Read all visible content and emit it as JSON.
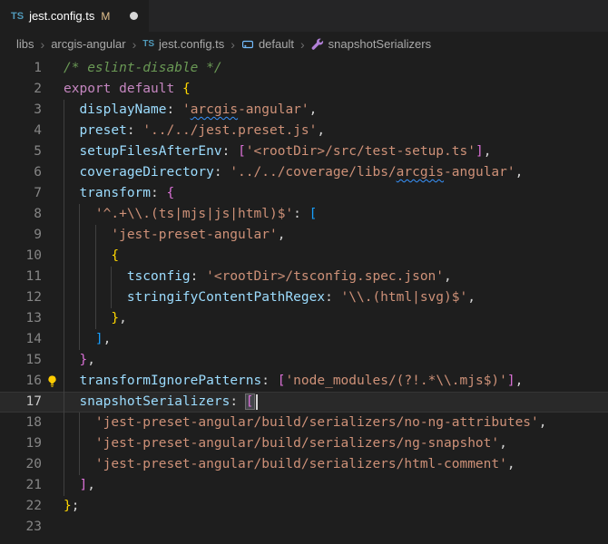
{
  "icons": {
    "ts": "TS"
  },
  "tab": {
    "title": "jest.config.ts",
    "git_status": "M",
    "dirty": true
  },
  "breadcrumb": {
    "separator": "›",
    "items": [
      {
        "label": "libs"
      },
      {
        "label": "arcgis-angular"
      },
      {
        "label": "jest.config.ts",
        "icon": "ts-file-icon"
      },
      {
        "label": "default",
        "icon": "symbol-variable-icon"
      },
      {
        "label": "snapshotSerializers",
        "icon": "symbol-property-icon"
      }
    ]
  },
  "editor": {
    "language": "typescript",
    "active_line": 17,
    "colors": {
      "comment": "#6A9955",
      "keyword": "#C586C0",
      "property": "#9CDCFE",
      "string": "#CE9178",
      "punctuation": "#D4D4D4",
      "bracket1": "#FFD700",
      "bracket2": "#DA70D6",
      "bracket3": "#179FFF",
      "squiggle": "#3794FF"
    },
    "lines": [
      {
        "num": 1,
        "guides": 0,
        "tokens": [
          {
            "s": "/* eslint-disable */",
            "c": "com"
          }
        ]
      },
      {
        "num": 2,
        "guides": 0,
        "tokens": [
          {
            "s": "export default ",
            "c": "kw"
          },
          {
            "s": "{",
            "c": "b1"
          }
        ]
      },
      {
        "num": 3,
        "guides": 1,
        "tokens": [
          {
            "s": "displayName",
            "c": "prop"
          },
          {
            "s": ": ",
            "c": "pun"
          },
          {
            "s": "'",
            "c": "str"
          },
          {
            "s": "arcgis",
            "c": "str",
            "sq": true
          },
          {
            "s": "-angular'",
            "c": "str"
          },
          {
            "s": ",",
            "c": "pun"
          }
        ]
      },
      {
        "num": 4,
        "guides": 1,
        "tokens": [
          {
            "s": "preset",
            "c": "prop"
          },
          {
            "s": ": ",
            "c": "pun"
          },
          {
            "s": "'../../jest.preset.js'",
            "c": "str"
          },
          {
            "s": ",",
            "c": "pun"
          }
        ]
      },
      {
        "num": 5,
        "guides": 1,
        "tokens": [
          {
            "s": "setupFilesAfterEnv",
            "c": "prop"
          },
          {
            "s": ": ",
            "c": "pun"
          },
          {
            "s": "[",
            "c": "b2"
          },
          {
            "s": "'<rootDir>/src/test-setup.ts'",
            "c": "str"
          },
          {
            "s": "]",
            "c": "b2"
          },
          {
            "s": ",",
            "c": "pun"
          }
        ]
      },
      {
        "num": 6,
        "guides": 1,
        "tokens": [
          {
            "s": "coverageDirectory",
            "c": "prop"
          },
          {
            "s": ": ",
            "c": "pun"
          },
          {
            "s": "'../../coverage/libs/",
            "c": "str"
          },
          {
            "s": "arcgis",
            "c": "str",
            "sq": true
          },
          {
            "s": "-angular'",
            "c": "str"
          },
          {
            "s": ",",
            "c": "pun"
          }
        ]
      },
      {
        "num": 7,
        "guides": 1,
        "tokens": [
          {
            "s": "transform",
            "c": "prop"
          },
          {
            "s": ": ",
            "c": "pun"
          },
          {
            "s": "{",
            "c": "b2"
          }
        ]
      },
      {
        "num": 8,
        "guides": 2,
        "tokens": [
          {
            "s": "'^.+\\\\.(ts|mjs|js|html)$'",
            "c": "str"
          },
          {
            "s": ": ",
            "c": "pun"
          },
          {
            "s": "[",
            "c": "b3"
          }
        ]
      },
      {
        "num": 9,
        "guides": 3,
        "tokens": [
          {
            "s": "'jest-preset-angular'",
            "c": "str"
          },
          {
            "s": ",",
            "c": "pun"
          }
        ]
      },
      {
        "num": 10,
        "guides": 3,
        "tokens": [
          {
            "s": "{",
            "c": "b1"
          }
        ]
      },
      {
        "num": 11,
        "guides": 4,
        "tokens": [
          {
            "s": "tsconfig",
            "c": "prop"
          },
          {
            "s": ": ",
            "c": "pun"
          },
          {
            "s": "'<rootDir>/tsconfig.spec.json'",
            "c": "str"
          },
          {
            "s": ",",
            "c": "pun"
          }
        ]
      },
      {
        "num": 12,
        "guides": 4,
        "tokens": [
          {
            "s": "stringifyContentPathRegex",
            "c": "prop"
          },
          {
            "s": ": ",
            "c": "pun"
          },
          {
            "s": "'\\\\.(html|svg)$'",
            "c": "str"
          },
          {
            "s": ",",
            "c": "pun"
          }
        ]
      },
      {
        "num": 13,
        "guides": 3,
        "tokens": [
          {
            "s": "}",
            "c": "b1"
          },
          {
            "s": ",",
            "c": "pun"
          }
        ]
      },
      {
        "num": 14,
        "guides": 2,
        "tokens": [
          {
            "s": "]",
            "c": "b3"
          },
          {
            "s": ",",
            "c": "pun"
          }
        ]
      },
      {
        "num": 15,
        "guides": 1,
        "tokens": [
          {
            "s": "}",
            "c": "b2"
          },
          {
            "s": ",",
            "c": "pun"
          }
        ]
      },
      {
        "num": 16,
        "guides": 1,
        "lightbulb": true,
        "tokens": [
          {
            "s": "transformIgnorePatterns",
            "c": "prop"
          },
          {
            "s": ": ",
            "c": "pun"
          },
          {
            "s": "[",
            "c": "b2"
          },
          {
            "s": "'node_modules/(?!.*\\\\.mjs$)'",
            "c": "str"
          },
          {
            "s": "]",
            "c": "b2"
          },
          {
            "s": ",",
            "c": "pun"
          }
        ]
      },
      {
        "num": 17,
        "guides": 1,
        "active": true,
        "tokens": [
          {
            "s": "snapshotSerializers",
            "c": "prop"
          },
          {
            "s": ": ",
            "c": "pun"
          },
          {
            "s": "[",
            "c": "b2",
            "match": true,
            "cursor": true
          }
        ]
      },
      {
        "num": 18,
        "guides": 2,
        "tokens": [
          {
            "s": "'jest-preset-angular/build/serializers/no-ng-attributes'",
            "c": "str"
          },
          {
            "s": ",",
            "c": "pun"
          }
        ]
      },
      {
        "num": 19,
        "guides": 2,
        "tokens": [
          {
            "s": "'jest-preset-angular/build/serializers/ng-snapshot'",
            "c": "str"
          },
          {
            "s": ",",
            "c": "pun"
          }
        ]
      },
      {
        "num": 20,
        "guides": 2,
        "tokens": [
          {
            "s": "'jest-preset-angular/build/serializers/html-comment'",
            "c": "str"
          },
          {
            "s": ",",
            "c": "pun"
          }
        ]
      },
      {
        "num": 21,
        "guides": 1,
        "tokens": [
          {
            "s": "]",
            "c": "b2"
          },
          {
            "s": ",",
            "c": "pun"
          }
        ]
      },
      {
        "num": 22,
        "guides": 0,
        "tokens": [
          {
            "s": "}",
            "c": "b1"
          },
          {
            "s": ";",
            "c": "pun"
          }
        ]
      },
      {
        "num": 23,
        "guides": 0,
        "tokens": []
      }
    ]
  }
}
